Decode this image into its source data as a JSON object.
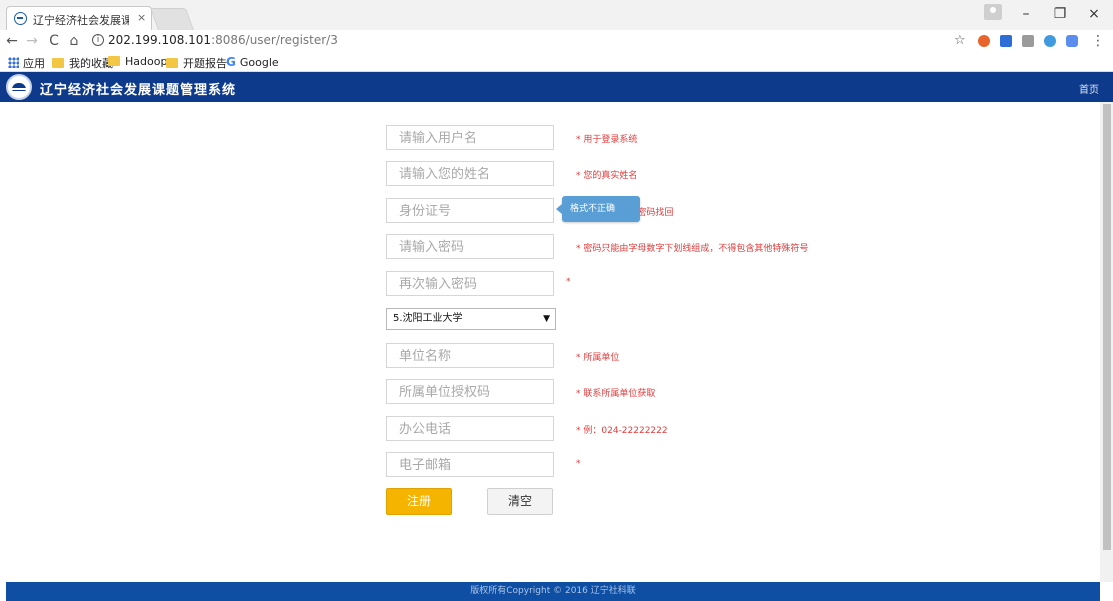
{
  "browser": {
    "tab_title": "辽宁经济社会发展课题管",
    "tab_close": "×",
    "url_host": "202.199.108.101",
    "url_path": ":8086/user/register/3",
    "info_icon": "info-icon",
    "window_controls": [
      "–",
      "❐",
      "×"
    ],
    "nav": [
      "←",
      "→",
      "C",
      "⌂"
    ],
    "bookmarks": [
      {
        "label": "应用",
        "icon": "apps-icon"
      },
      {
        "label": "我的收藏",
        "icon": "folder-icon"
      },
      {
        "label": "Hadoop",
        "icon": "folder-icon"
      },
      {
        "label": "开题报告",
        "icon": "folder-icon"
      },
      {
        "label": "Google",
        "icon": "google-icon"
      }
    ],
    "google_glyph": "G",
    "extension_colors": [
      "#e8642a",
      "#2c6ed5",
      "#9b9b9b",
      "#3f9ae0",
      "#5b8def"
    ]
  },
  "site": {
    "title": "辽宁经济社会发展课题管理系统",
    "home_link": "首页",
    "header_color": "#0e3a8c"
  },
  "form": {
    "username_placeholder": "请输入用户名",
    "username_hint": "* 用于登录系统",
    "realname_placeholder": "请输入您的姓名",
    "realname_hint": "* 您的真实姓名",
    "idcard_placeholder": "身份证号",
    "idcard_hint": "* 用于密码找回",
    "tooltip": "格式不正确",
    "password_placeholder": "请输入密码",
    "password_hint": "* 密码只能由字母数字下划线组成，不得包含其他特殊符号",
    "password2_placeholder": "再次输入密码",
    "password2_hint": "*",
    "school_selected": "5.沈阳工业大学",
    "unit_placeholder": "单位名称",
    "unit_hint": "* 所属单位",
    "authcode_placeholder": "所属单位授权码",
    "authcode_hint": "* 联系所属单位获取",
    "phone_placeholder": "办公电话",
    "phone_hint": "* 例：024-22222222",
    "email_placeholder": "电子邮箱",
    "email_hint": "*",
    "register_label": "注册",
    "clear_label": "清空",
    "accent_color": "#f4b400",
    "hint_color": "#e23b3b"
  },
  "footer": {
    "text": "版权所有Copyright © 2016 辽宁社科联"
  }
}
